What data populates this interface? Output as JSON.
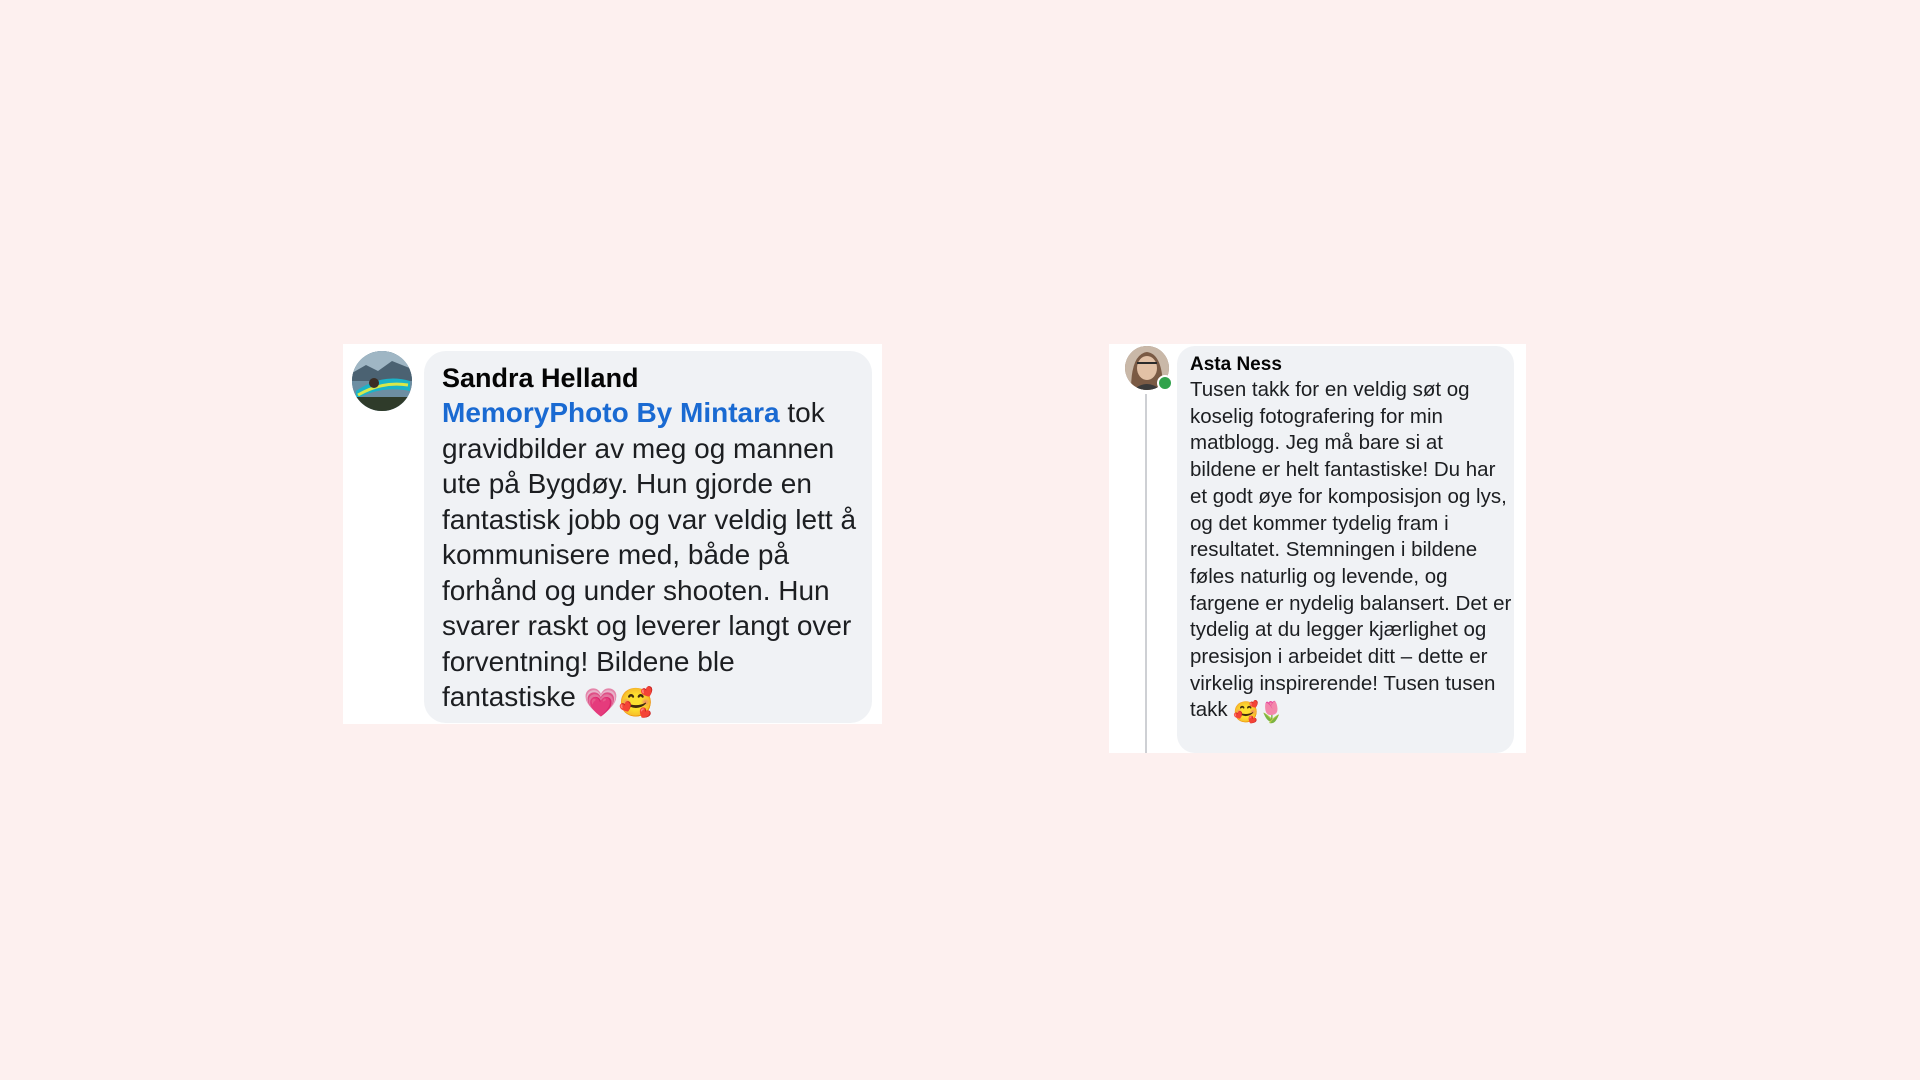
{
  "comments": [
    {
      "author": "Sandra Helland",
      "mention": "MemoryPhoto By Mintara",
      "body": "tok gravidbilder av meg og mannen ute på Bygdøy. Hun gjorde en fantastisk jobb og var veldig lett å kommunisere med, både på forhånd og under shooten. Hun svarer raskt og leverer langt over forventning! Bildene ble fantastiske",
      "emojis": [
        "💗",
        "🥰"
      ]
    },
    {
      "author": "Asta Ness",
      "body": "Tusen takk for en veldig søt og koselig fotografering for min matblogg. Jeg må bare si at bildene  er helt fantastiske! Du har et godt øye for komposisjon og lys, og det kommer tydelig fram i resultatet. Stemningen i bildene føles naturlig og levende, og fargene er nydelig balansert. Det er tydelig at du legger kjærlighet og presisjon i arbeidet ditt – dette er virkelig inspirerende! Tusen tusen takk",
      "emojis": [
        "🥰",
        "🌷"
      ]
    }
  ],
  "colors": {
    "page_background": "#fdf0ef",
    "bubble": "#f0f2f5",
    "mention_link": "#1a6ad2",
    "online_status": "#31a24c"
  },
  "icons": [
    "avatar",
    "online-status-icon"
  ]
}
